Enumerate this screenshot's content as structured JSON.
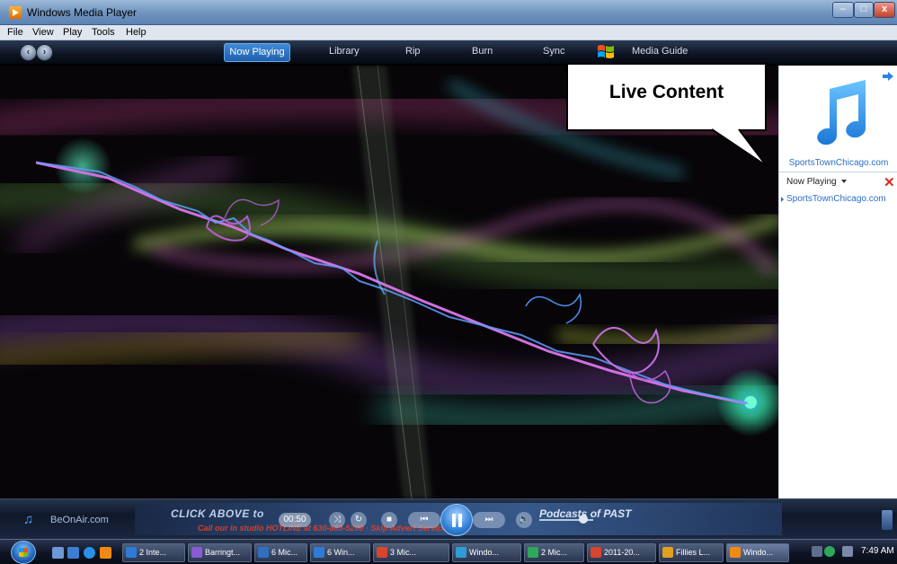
{
  "window": {
    "title": "Windows Media Player"
  },
  "menu": [
    "File",
    "View",
    "Play",
    "Tools",
    "Help"
  ],
  "nav": {
    "tabs": [
      {
        "label": "Now Playing",
        "active": true
      },
      {
        "label": "Library"
      },
      {
        "label": "Rip"
      },
      {
        "label": "Burn"
      },
      {
        "label": "Sync"
      },
      {
        "label": "Media Guide"
      }
    ]
  },
  "pane": {
    "source_name": "SportsTownChicago.com",
    "list_title": "Now Playing",
    "playlist": [
      "SportsTownChicago.com"
    ]
  },
  "callout": {
    "text": "Live Content"
  },
  "transport": {
    "station": "BeOnAir.com",
    "time": "00:50",
    "ad_line1": "CLICK ABOVE to",
    "ad_line2": "Call our in studio HOTLINE at 630-883-5200 · Skip Advert Service",
    "ad_right": "Podcasts of PAST"
  },
  "taskbar": {
    "tasks": [
      {
        "label": "2 Inte...",
        "color": "#2e7bd6"
      },
      {
        "label": "Barringt...",
        "color": "#8a5bd6"
      },
      {
        "label": "6 Mic...",
        "color": "#2e6fc0"
      },
      {
        "label": "6 Win...",
        "color": "#2e7bd6"
      },
      {
        "label": "3 Mic...",
        "color": "#d6452e"
      },
      {
        "label": "Windo...",
        "color": "#2e9bd6"
      },
      {
        "label": "2 Mic...",
        "color": "#2ea85a"
      },
      {
        "label": "2011-20...",
        "color": "#d6452e"
      },
      {
        "label": "Fillies L...",
        "color": "#e0a020"
      },
      {
        "label": "Windo...",
        "color": "#f08a10",
        "active": true
      }
    ],
    "clock": "7:49 AM"
  },
  "colors": {
    "accent": "#2f7fd6",
    "callout_border": "#000000",
    "link": "#2b6ec8"
  }
}
